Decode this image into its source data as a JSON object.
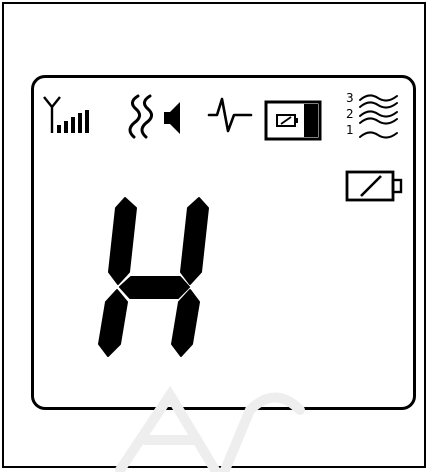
{
  "display": {
    "status_icons": [
      "signal-strength-icon",
      "heat-sound-icon",
      "pulse-icon",
      "battery-box-icon",
      "fan-speed-icon"
    ],
    "fan_speed_levels": [
      "3",
      "2",
      "1"
    ],
    "battery_indicator": "battery-low-icon",
    "main_digit": "H"
  },
  "colors": {
    "ink": "#000000",
    "background": "#ffffff",
    "watermark": "#f0f0f0"
  }
}
